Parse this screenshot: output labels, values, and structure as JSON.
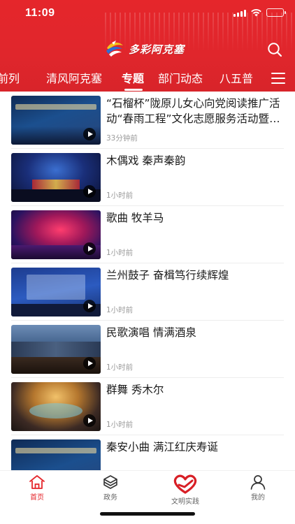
{
  "status_bar": {
    "time": "11:09"
  },
  "header": {
    "app_title": "多彩阿克塞"
  },
  "tabs": [
    {
      "label": "前列"
    },
    {
      "label": "清风阿克塞"
    },
    {
      "label": "专题",
      "active": true
    },
    {
      "label": "部门动态"
    },
    {
      "label": "八五普"
    }
  ],
  "articles": [
    {
      "title": "“石榴杯”陇原儿女心向党阅读推广活动“春雨工程”文化志愿服务活动暨非遗展演",
      "time": "33分钟前",
      "has_video": true
    },
    {
      "title": "木偶戏  秦声秦韵",
      "time": "1小时前",
      "has_video": true
    },
    {
      "title": "歌曲  牧羊马",
      "time": "1小时前",
      "has_video": true
    },
    {
      "title": "兰州鼓子  奋楫笃行续辉煌",
      "time": "1小时前",
      "has_video": true
    },
    {
      "title": "民歌演唱  情满酒泉",
      "time": "1小时前",
      "has_video": true
    },
    {
      "title": "群舞  秀木尔",
      "time": "1小时前",
      "has_video": true
    },
    {
      "title": "秦安小曲  满江红庆寿诞",
      "time": "",
      "has_video": false
    }
  ],
  "bottom_nav": [
    {
      "label": "首页",
      "icon": "home-icon",
      "active": true
    },
    {
      "label": "政务",
      "icon": "cube-icon"
    },
    {
      "label": "文明实践",
      "icon": "heart-hand-icon"
    },
    {
      "label": "我的",
      "icon": "person-icon"
    }
  ],
  "colors": {
    "brand_red": "#e5262b",
    "active_nav": "#e5262b",
    "text_primary": "#1a1a1a",
    "text_muted": "#9a9a9a"
  }
}
